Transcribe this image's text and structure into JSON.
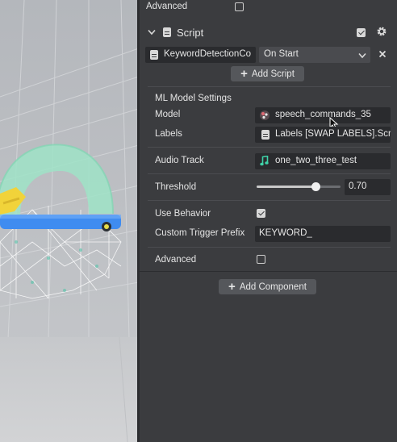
{
  "inspector": {
    "top_advanced_label": "Advanced",
    "script_component": {
      "title": "Script",
      "script_field_value": "KeywordDetectionCo",
      "trigger_select_value": "On Start",
      "add_script_label": "Add Script"
    },
    "ml_section": {
      "heading": "ML Model Settings",
      "model_label": "Model",
      "model_value": "speech_commands_35",
      "labels_label": "Labels",
      "labels_value": "Labels [SWAP LABELS].Scr",
      "audio_track_label": "Audio Track",
      "audio_track_value": "one_two_three_test",
      "threshold_label": "Threshold",
      "threshold_value": "0.70",
      "threshold_slider_level": 0.7,
      "use_behavior_label": "Use Behavior",
      "use_behavior_checked": true,
      "custom_trigger_prefix_label": "Custom Trigger Prefix",
      "custom_trigger_prefix_value": "KEYWORD_",
      "advanced_label": "Advanced",
      "advanced_checked": false
    },
    "add_component_label": "Add Component"
  }
}
